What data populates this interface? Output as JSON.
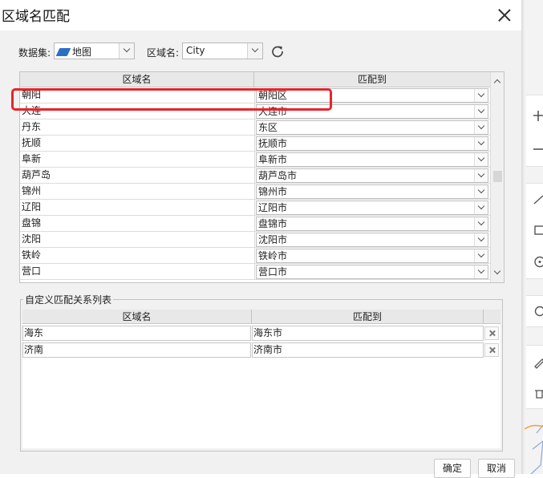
{
  "dialog": {
    "title": "区域名匹配",
    "dataset_label": "数据集:",
    "dataset_value": "地图",
    "region_label": "区域名:",
    "region_value": "City"
  },
  "main_table": {
    "headers": [
      "区域名",
      "匹配到"
    ],
    "rows": [
      {
        "name": "朝阳",
        "match": "朝阳区"
      },
      {
        "name": "大连",
        "match": "大连市"
      },
      {
        "name": "丹东",
        "match": "东区"
      },
      {
        "name": "抚顺",
        "match": "抚顺市"
      },
      {
        "name": "阜新",
        "match": "阜新市"
      },
      {
        "name": "葫芦岛",
        "match": "葫芦岛市"
      },
      {
        "name": "锦州",
        "match": "锦州市"
      },
      {
        "name": "辽阳",
        "match": "辽阳市"
      },
      {
        "name": "盘锦",
        "match": "盘锦市"
      },
      {
        "name": "沈阳",
        "match": "沈阳市"
      },
      {
        "name": "铁岭",
        "match": "铁岭市"
      },
      {
        "name": "营口",
        "match": "营口市"
      }
    ]
  },
  "custom_group": {
    "title": "自定义匹配关系列表",
    "headers": [
      "区域名",
      "匹配到"
    ],
    "rows": [
      {
        "name": "海东",
        "match": "海东市"
      },
      {
        "name": "济南",
        "match": "济南市"
      }
    ]
  },
  "buttons": {
    "ok": "确定",
    "cancel": "取消"
  },
  "colors": {
    "highlight": "#e8242b",
    "accent": "#2a6fc4"
  }
}
